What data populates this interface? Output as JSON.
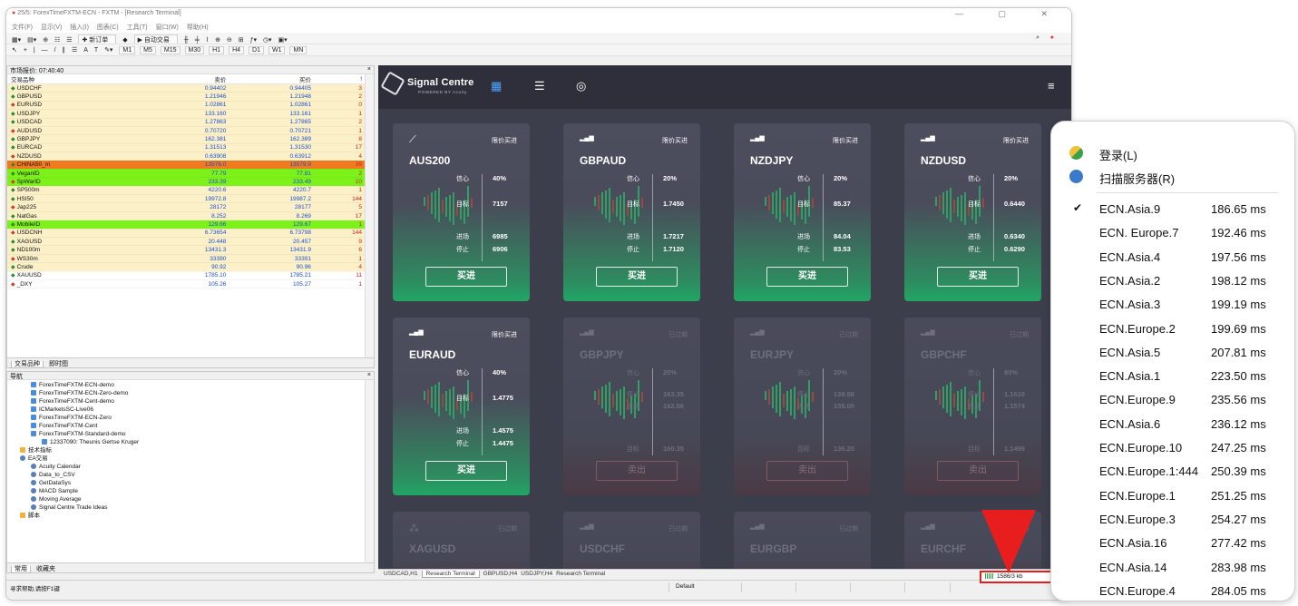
{
  "window": {
    "title": "25/5: ForexTimeFXTM-ECN - FXTM - [Research Terminal]",
    "controls": "—  ▢  ✕",
    "menu": [
      "文件(F)",
      "显示(V)",
      "插入(I)",
      "图表(C)",
      "工具(T)",
      "窗口(W)",
      "帮助(H)"
    ],
    "toolbar_new_order": "新订单",
    "toolbar_autotrade": "自动交易",
    "timeframes": [
      "M1",
      "M5",
      "M15",
      "M30",
      "H1",
      "H4",
      "D1",
      "W1",
      "MN"
    ]
  },
  "market_watch": {
    "title": "市场报价: 07:40:40",
    "columns": [
      "交易品种",
      "卖价",
      "买价",
      "!"
    ],
    "rows": [
      {
        "symbol": "USDCHF",
        "bid": "0.94402",
        "ask": "0.94405",
        "spread": "3",
        "hl": "yellow"
      },
      {
        "symbol": "GBPUSD",
        "bid": "1.21946",
        "ask": "1.21948",
        "spread": "2",
        "hl": "yellow"
      },
      {
        "symbol": "EURUSD",
        "bid": "1.02861",
        "ask": "1.02861",
        "spread": "0",
        "hl": "yellow"
      },
      {
        "symbol": "USDJPY",
        "bid": "133.160",
        "ask": "133.161",
        "spread": "1",
        "hl": "yellow"
      },
      {
        "symbol": "USDCAD",
        "bid": "1.27863",
        "ask": "1.27865",
        "spread": "2",
        "hl": "yellow"
      },
      {
        "symbol": "AUDUSD",
        "bid": "0.70720",
        "ask": "0.70721",
        "spread": "1",
        "hl": "yellow"
      },
      {
        "symbol": "GBPJPY",
        "bid": "162.381",
        "ask": "162.389",
        "spread": "8",
        "hl": "yellow"
      },
      {
        "symbol": "EURCAD",
        "bid": "1.31513",
        "ask": "1.31530",
        "spread": "17",
        "hl": "yellow"
      },
      {
        "symbol": "NZDUSD",
        "bid": "0.63908",
        "ask": "0.63912",
        "spread": "4",
        "hl": "yellow"
      },
      {
        "symbol": "CHINA50_m",
        "bid": "13576.0",
        "ask": "13579.9",
        "spread": "39",
        "hl": "orange"
      },
      {
        "symbol": "VeganID",
        "bid": "77.79",
        "ask": "77.81",
        "spread": "2",
        "hl": "green"
      },
      {
        "symbol": "SpWarID",
        "bid": "233.39",
        "ask": "233.49",
        "spread": "10",
        "hl": "green"
      },
      {
        "symbol": "SP500m",
        "bid": "4220.6",
        "ask": "4220.7",
        "spread": "1",
        "hl": "yellow"
      },
      {
        "symbol": "HSI50",
        "bid": "19972.8",
        "ask": "19987.2",
        "spread": "144",
        "hl": "yellow"
      },
      {
        "symbol": "Jap225",
        "bid": "28172",
        "ask": "28177",
        "spread": "5",
        "hl": "yellow"
      },
      {
        "symbol": "NatGas",
        "bid": "8.252",
        "ask": "8.269",
        "spread": "17",
        "hl": "yellow"
      },
      {
        "symbol": "MobileID",
        "bid": "129.66",
        "ask": "129.67",
        "spread": "1",
        "hl": "green"
      },
      {
        "symbol": "USDCNH",
        "bid": "6.73654",
        "ask": "6.73798",
        "spread": "144",
        "hl": "yellow"
      },
      {
        "symbol": "XAGUSD",
        "bid": "20.448",
        "ask": "20.457",
        "spread": "9",
        "hl": "yellow"
      },
      {
        "symbol": "ND100m",
        "bid": "13431.3",
        "ask": "13431.9",
        "spread": "6",
        "hl": "yellow"
      },
      {
        "symbol": "WS30m",
        "bid": "33390",
        "ask": "33391",
        "spread": "1",
        "hl": "yellow"
      },
      {
        "symbol": "Crude",
        "bid": "90.92",
        "ask": "90.96",
        "spread": "4",
        "hl": "yellow"
      },
      {
        "symbol": "XAUUSD",
        "bid": "1785.10",
        "ask": "1785.21",
        "spread": "11",
        "hl": "none"
      },
      {
        "symbol": "_DXY",
        "bid": "105.26",
        "ask": "105.27",
        "spread": "1",
        "hl": "none"
      }
    ],
    "tabs": [
      "交易品种",
      "即时图"
    ]
  },
  "navigator": {
    "title": "导航",
    "items": [
      {
        "label": "ForexTimeFXTM-ECN-demo",
        "indent": 1,
        "kind": "acct"
      },
      {
        "label": "ForexTimeFXTM-ECN-Zero-demo",
        "indent": 1,
        "kind": "acct"
      },
      {
        "label": "ForexTimeFXTM-Cent-demo",
        "indent": 1,
        "kind": "acct"
      },
      {
        "label": "ICMarketsSC-Live06",
        "indent": 1,
        "kind": "acct"
      },
      {
        "label": "ForexTimeFXTM-ECN-Zero",
        "indent": 1,
        "kind": "acct"
      },
      {
        "label": "ForexTimeFXTM-Cent",
        "indent": 1,
        "kind": "acct"
      },
      {
        "label": "ForexTimeFXTM-Standard-demo",
        "indent": 1,
        "kind": "acct"
      },
      {
        "label": "12337090: Theunis Gertse Kruger",
        "indent": 2,
        "kind": "user"
      },
      {
        "label": "技术指标",
        "indent": 0,
        "kind": "ind"
      },
      {
        "label": "EA交易",
        "indent": 0,
        "kind": "ea"
      },
      {
        "label": "Acuity Calendar",
        "indent": 1,
        "kind": "ea"
      },
      {
        "label": "Data_to_CSV",
        "indent": 1,
        "kind": "ea"
      },
      {
        "label": "GetDataSys",
        "indent": 1,
        "kind": "ea"
      },
      {
        "label": "MACD Sample",
        "indent": 1,
        "kind": "ea"
      },
      {
        "label": "Moving Average",
        "indent": 1,
        "kind": "ea"
      },
      {
        "label": "Signal Centre Trade Ideas",
        "indent": 1,
        "kind": "ea"
      },
      {
        "label": "脚本",
        "indent": 0,
        "kind": "ind"
      }
    ],
    "tabs": [
      "常用",
      "收藏夹"
    ]
  },
  "signal_centre": {
    "brand": "Signal Centre",
    "brand_sub": "POWERED BY Acuity",
    "labels": {
      "confidence": "信心",
      "target": "目标",
      "entry": "进场",
      "stop": "停止"
    },
    "cards": [
      {
        "symbol": "AUS200",
        "type": "限价买进",
        "icon": "line-chart-icon",
        "confidence": "40%",
        "target": "7157",
        "entry": "6985",
        "stop": "6906",
        "action": "买进",
        "expired": false
      },
      {
        "symbol": "GBPAUD",
        "type": "限价买进",
        "icon": "bars-icon",
        "confidence": "20%",
        "target": "1.7450",
        "entry": "1.7217",
        "stop": "1.7120",
        "action": "买进",
        "expired": false
      },
      {
        "symbol": "NZDJPY",
        "type": "限价买进",
        "icon": "bars-icon",
        "confidence": "20%",
        "target": "85.37",
        "entry": "84.04",
        "stop": "83.53",
        "action": "买进",
        "expired": false
      },
      {
        "symbol": "NZDUSD",
        "type": "限价买进",
        "icon": "bars-icon",
        "confidence": "20%",
        "target": "0.6440",
        "entry": "0.6340",
        "stop": "0.6290",
        "action": "买进",
        "expired": false
      },
      {
        "symbol": "EURAUD",
        "type": "限价买进",
        "icon": "bars-icon",
        "confidence": "40%",
        "target": "1.4775",
        "entry": "1.4575",
        "stop": "1.4475",
        "action": "买进",
        "expired": false
      },
      {
        "symbol": "GBPJPY",
        "type": "已过期",
        "icon": "bars-icon",
        "confidence": "20%",
        "stop": "163.35",
        "entry": "162.56",
        "target": "160.35",
        "action": "卖出",
        "expired": true
      },
      {
        "symbol": "EURJPY",
        "type": "已过期",
        "icon": "bars-icon",
        "confidence": "20%",
        "stop": "139.98",
        "entry": "139.00",
        "target": "136.20",
        "action": "卖出",
        "expired": true
      },
      {
        "symbol": "GBPCHF",
        "type": "已过期",
        "icon": "bars-icon",
        "confidence": "80%",
        "stop": "1.1610",
        "entry": "1.1574",
        "target": "1.1499",
        "action": "卖出",
        "expired": true
      },
      {
        "symbol": "XAGUSD",
        "type": "已过期",
        "icon": "nodes-icon",
        "expired": true,
        "partial": true
      },
      {
        "symbol": "USDCHF",
        "type": "已过期",
        "icon": "bars-icon",
        "expired": true,
        "partial": true
      },
      {
        "symbol": "EURGBP",
        "type": "已过期",
        "icon": "bars-icon",
        "expired": true,
        "partial": true
      },
      {
        "symbol": "EURCHF",
        "type": "已过期",
        "icon": "bars-icon",
        "expired": true,
        "partial": true
      }
    ]
  },
  "chart_tabs": [
    "USDCAD,H1",
    "Research Terminal",
    "GBPUSD,H4",
    "USDJPY,H4",
    "Research Terminal"
  ],
  "status": {
    "help": "寻求帮助,请按F1键",
    "profile": "Default",
    "connection": "1586/3 kb"
  },
  "popup": {
    "login": "登录(L)",
    "scan": "扫描服务器(R)",
    "servers": [
      {
        "name": "ECN.Asia.9",
        "ping": "186.65 ms",
        "checked": true
      },
      {
        "name": "ECN. Europe.7",
        "ping": "192.46 ms"
      },
      {
        "name": "ECN.Asia.4",
        "ping": "197.56 ms"
      },
      {
        "name": "ECN.Asia.2",
        "ping": "198.12 ms"
      },
      {
        "name": "ECN.Asia.3",
        "ping": "199.19 ms"
      },
      {
        "name": "ECN.Europe.2",
        "ping": "199.69 ms"
      },
      {
        "name": "ECN.Asia.5",
        "ping": "207.81 ms"
      },
      {
        "name": "ECN.Asia.1",
        "ping": "223.50 ms"
      },
      {
        "name": "ECN.Europe.9",
        "ping": "235.56 ms"
      },
      {
        "name": "ECN.Asia.6",
        "ping": "236.12 ms"
      },
      {
        "name": "ECN.Europe.10",
        "ping": "247.25 ms"
      },
      {
        "name": "ECN.Europe.1:444",
        "ping": "250.39 ms"
      },
      {
        "name": "ECN.Europe.1",
        "ping": "251.25 ms"
      },
      {
        "name": "ECN.Europe.3",
        "ping": "254.27 ms"
      },
      {
        "name": "ECN.Asia.16",
        "ping": "277.42 ms"
      },
      {
        "name": "ECN.Asia.14",
        "ping": "283.98 ms"
      },
      {
        "name": "ECN.Europe.4",
        "ping": "284.05 ms"
      }
    ]
  },
  "colors": {
    "yellow": "#fbf0c8",
    "orange": "#f07a1e",
    "green": "#7cf21a",
    "accent_red": "#e81d1d",
    "card_green": "#22a565"
  }
}
